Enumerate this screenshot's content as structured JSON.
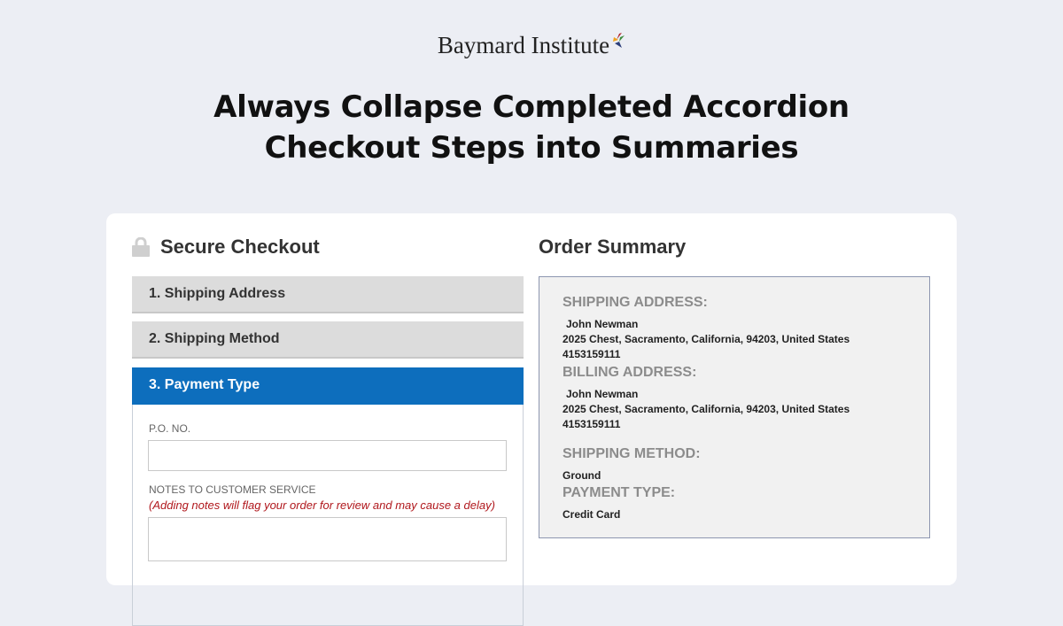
{
  "brand": {
    "name": "Baymard Institute"
  },
  "headline": {
    "line1": "Always Collapse Completed Accordion",
    "line2": "Checkout Steps into Summaries"
  },
  "checkout": {
    "title": "Secure Checkout",
    "steps": [
      {
        "label": "1. Shipping Address"
      },
      {
        "label": "2. Shipping Method"
      },
      {
        "label": "3. Payment Type"
      }
    ],
    "po_label": "P.O. NO.",
    "po_value": "",
    "notes_label": "NOTES TO CUSTOMER SERVICE",
    "notes_warning": "(Adding notes will flag your order for review and may cause a delay)",
    "notes_value": ""
  },
  "order_summary": {
    "title": "Order Summary",
    "shipping_address": {
      "heading": "SHIPPING ADDRESS:",
      "name": "John Newman",
      "address": "2025 Chest,  Sacramento,  California,  94203,  United States",
      "phone": "4153159111"
    },
    "billing_address": {
      "heading": "BILLING ADDRESS:",
      "name": "John Newman",
      "address": "2025 Chest,  Sacramento,  California,  94203,  United States",
      "phone": "4153159111"
    },
    "shipping_method": {
      "heading": "SHIPPING METHOD:",
      "value": "Ground"
    },
    "payment_type": {
      "heading": "PAYMENT TYPE:",
      "value": "Credit Card"
    }
  },
  "colors": {
    "background": "#eceef4",
    "active_step": "#0d6ebd",
    "warning_text": "#b0171c",
    "summary_border": "#8d96b0"
  },
  "icons": {
    "lock": "lock-icon",
    "brand_mark": "bird-logo-icon"
  }
}
